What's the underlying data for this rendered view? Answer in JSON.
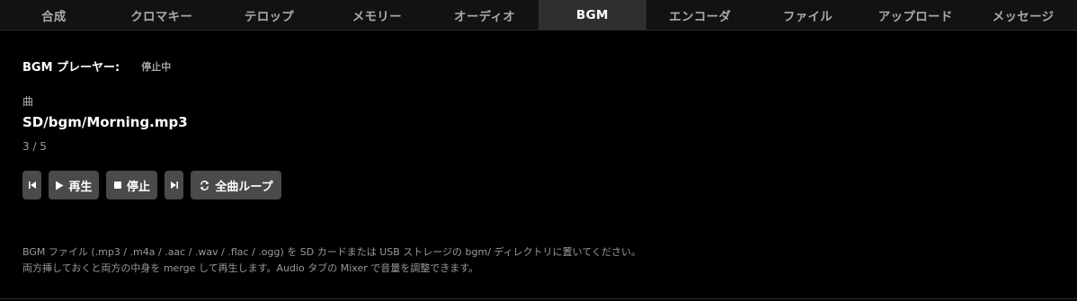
{
  "tabs": [
    {
      "label": "合成"
    },
    {
      "label": "クロマキー"
    },
    {
      "label": "テロップ"
    },
    {
      "label": "メモリー"
    },
    {
      "label": "オーディオ"
    },
    {
      "label": "BGM",
      "active": true
    },
    {
      "label": "エンコーダ"
    },
    {
      "label": "ファイル"
    },
    {
      "label": "アップロード"
    },
    {
      "label": "メッセージ"
    }
  ],
  "player": {
    "label": "BGM プレーヤー:",
    "status": "停止中"
  },
  "song": {
    "label": "曲",
    "path": "SD/bgm/Morning.mp3",
    "index": "3 / 5"
  },
  "controls": {
    "prev_icon": "skip-previous-icon",
    "play_icon": "play-icon",
    "play_label": "再生",
    "stop_icon": "stop-icon",
    "stop_label": "停止",
    "next_icon": "skip-next-icon",
    "loop_icon": "repeat-icon",
    "loop_label": "全曲ループ"
  },
  "help": {
    "line1": "BGM ファイル (.mp3 / .m4a / .aac / .wav / .flac / .ogg) を SD カードまたは USB ストレージの bgm/ ディレクトリに置いてください。",
    "line2": "両方挿しておくと両方の中身を merge して再生します。Audio タブの Mixer で音量を調整できます。"
  },
  "colors": {
    "background": "#000000",
    "tabbar": "#121212",
    "tab_active": "#2f2f2f",
    "button": "#4a4a4a"
  }
}
